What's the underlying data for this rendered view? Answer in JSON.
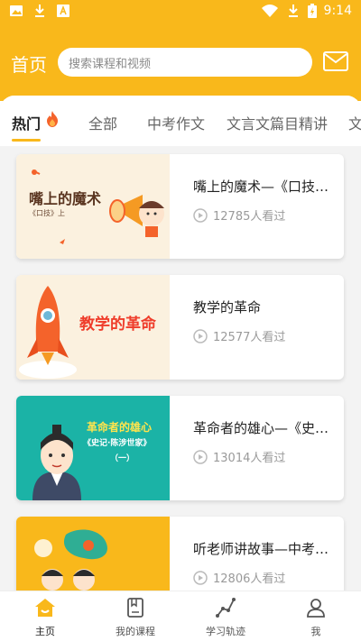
{
  "status_bar": {
    "time": "9:14",
    "icons": [
      "image-icon",
      "download-icon",
      "text-icon",
      "wifi-icon",
      "download-icon",
      "battery-icon"
    ]
  },
  "header": {
    "title": "首页",
    "search_placeholder": "搜索课程和视频",
    "mail_icon": "mail-icon"
  },
  "tabs": [
    {
      "label": "热门",
      "active": true,
      "icon": "fire-icon"
    },
    {
      "label": "全部"
    },
    {
      "label": "中考作文"
    },
    {
      "label": "文言文篇目精讲"
    },
    {
      "label": "文"
    }
  ],
  "courses": [
    {
      "title": "嘴上的魔术—《口技…",
      "views": "12785人看过",
      "thumb": {
        "caption": "嘴上的魔术",
        "subcaption": "《口技》上"
      }
    },
    {
      "title": "教学的革命",
      "views": "12577人看过",
      "thumb": {
        "caption": "教学的革命"
      }
    },
    {
      "title": "革命者的雄心—《史…",
      "views": "13014人看过",
      "thumb": {
        "caption": "革命者的雄心",
        "subcaption": "《史记·陈涉世家》",
        "part": "（一）"
      }
    },
    {
      "title": "听老师讲故事—中考…",
      "views": "12806人看过",
      "thumb": {}
    }
  ],
  "bottom_nav": [
    {
      "label": "主页",
      "icon": "home-icon",
      "active": true
    },
    {
      "label": "我的课程",
      "icon": "book-icon"
    },
    {
      "label": "学习轨迹",
      "icon": "trend-icon"
    },
    {
      "label": "我",
      "icon": "user-icon"
    }
  ],
  "colors": {
    "accent": "#f9b81b",
    "background": "#f3f3f3"
  }
}
